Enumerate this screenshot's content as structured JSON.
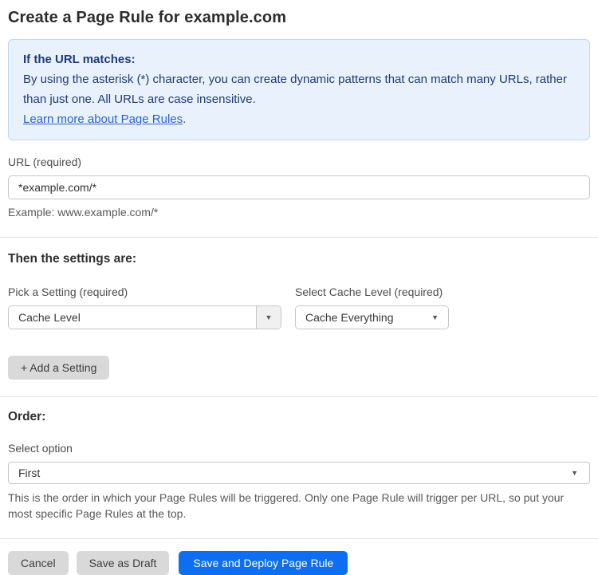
{
  "page": {
    "title": "Create a Page Rule for example.com"
  },
  "info_box": {
    "heading": "If the URL matches:",
    "body": "By using the asterisk (*) character, you can create dynamic patterns that can match many URLs, rather than just one. All URLs are case insensitive.",
    "link_label": "Learn more about Page Rules",
    "link_suffix": "."
  },
  "url_field": {
    "label": "URL (required)",
    "value": "*example.com/*",
    "helper": "Example: www.example.com/*"
  },
  "settings": {
    "heading": "Then the settings are:",
    "setting_picker": {
      "label": "Pick a Setting (required)",
      "value": "Cache Level"
    },
    "cache_level_picker": {
      "label": "Select Cache Level (required)",
      "value": "Cache Everything"
    },
    "add_button_label": "+ Add a Setting"
  },
  "order": {
    "heading": "Order:",
    "select_label": "Select option",
    "value": "First",
    "helper": "This is the order in which your Page Rules will be triggered. Only one Page Rule will trigger per URL, so put your most specific Page Rules at the top."
  },
  "footer": {
    "cancel_label": "Cancel",
    "save_draft_label": "Save as Draft",
    "save_deploy_label": "Save and Deploy Page Rule"
  },
  "icons": {
    "dropdown_arrow": "▼"
  },
  "colors": {
    "accent_blue": "#0d6ef2",
    "info_background": "#e9f1fc",
    "info_border": "#bed7f3",
    "info_text": "#1e3c77",
    "link_blue": "#2b62d0",
    "button_gray": "#d9d9d9"
  }
}
